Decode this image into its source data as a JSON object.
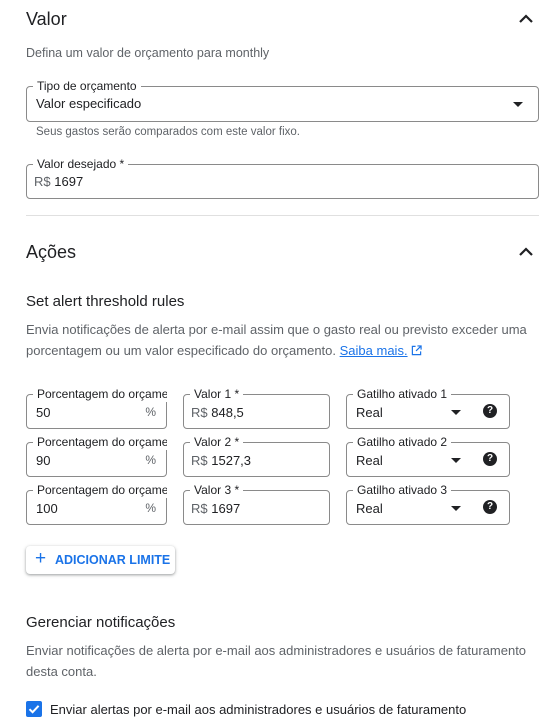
{
  "valor": {
    "title": "Valor",
    "description": "Defina um valor de orçamento para monthly",
    "budget_type": {
      "label": "Tipo de orçamento",
      "value": "Valor especificado",
      "helper": "Seus gastos serão comparados com este valor fixo."
    },
    "target": {
      "label": "Valor desejado *",
      "prefix": "R$",
      "value": "1697"
    }
  },
  "acoes": {
    "title": "Ações",
    "threshold_title": "Set alert threshold rules",
    "threshold_desc_line1": "Envia notificações de alerta por e-mail assim que o gasto real ou previsto exceder uma",
    "threshold_desc_line2": "porcentagem ou um valor especificado do orçamento.",
    "learn_more": "Saiba mais.",
    "rules": [
      {
        "percent_label": "Porcentagem do orçamento",
        "percent_value": "50",
        "percent_suffix": "%",
        "amount_label": "Valor 1 *",
        "amount_prefix": "R$",
        "amount_value": "848,5",
        "trigger_label": "Gatilho ativado 1",
        "trigger_value": "Real"
      },
      {
        "percent_label": "Porcentagem do orçamento",
        "percent_value": "90",
        "percent_suffix": "%",
        "amount_label": "Valor 2 *",
        "amount_prefix": "R$",
        "amount_value": "1527,3",
        "trigger_label": "Gatilho ativado 2",
        "trigger_value": "Real"
      },
      {
        "percent_label": "Porcentagem do orçamento",
        "percent_value": "100",
        "percent_suffix": "%",
        "amount_label": "Valor 3 *",
        "amount_prefix": "R$",
        "amount_value": "1697",
        "trigger_label": "Gatilho ativado 3",
        "trigger_value": "Real"
      }
    ],
    "add_threshold": "ADICIONAR LIMITE",
    "add_icon": "+"
  },
  "notifications": {
    "title": "Gerenciar notificações",
    "desc_line1": "Enviar notificações de alerta por e-mail aos administradores e usuários de faturamento",
    "desc_line2": "desta conta.",
    "checkbox_label": "Enviar alertas por e-mail aos administradores e usuários de faturamento",
    "checkbox_checked": true
  },
  "icons": {
    "collapse": "chevron-up-icon",
    "dropdown": "caret-down-icon",
    "help": "help-icon",
    "external": "open-in-new-icon",
    "check": "check-icon"
  },
  "colors": {
    "accent": "#1a73e8",
    "text": "#202124",
    "muted": "#5f6368",
    "border": "#8a8a8a"
  }
}
